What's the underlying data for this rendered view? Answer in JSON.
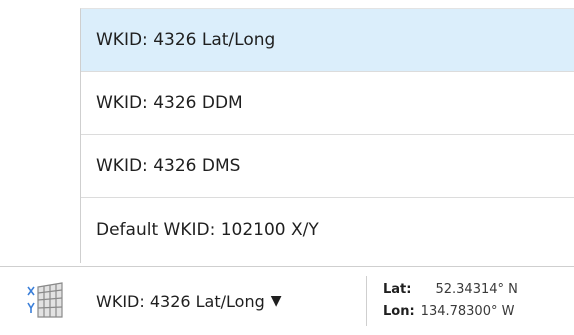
{
  "dropdown": {
    "items": [
      {
        "label": "WKID: 4326 Lat/Long",
        "selected": true
      },
      {
        "label": "WKID: 4326 DDM",
        "selected": false
      },
      {
        "label": "WKID: 4326 DMS",
        "selected": false
      },
      {
        "label": "Default WKID: 102100 X/Y",
        "selected": false
      }
    ]
  },
  "statusbar": {
    "icon": "xy-grid-icon",
    "selected_wkid": "WKID: 4326 Lat/Long",
    "arrow": "▼",
    "lat_label": "Lat:",
    "lat_value": "52.34314° N",
    "lon_label": "Lon:",
    "lon_value": "134.78300° W"
  },
  "colors": {
    "selected_bg": "#dbeefb",
    "icon_blue": "#3b7fd9",
    "icon_grid": "#8a8a8a"
  }
}
